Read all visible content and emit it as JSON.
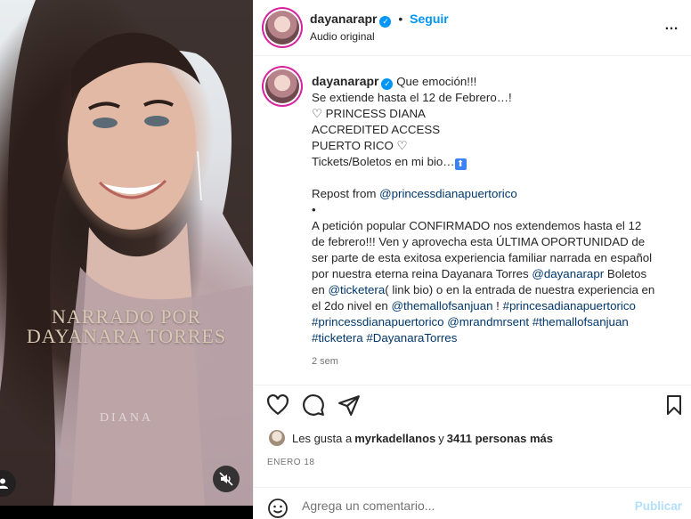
{
  "media": {
    "overlay_line1": "NARRADO POR",
    "overlay_line2": "DAYANARA TORRES",
    "watermark": "DIANA",
    "mute_icon": "speaker-muted-icon",
    "user_icon": "user-icon"
  },
  "header": {
    "username": "dayanarapr",
    "separator": "•",
    "follow_label": "Seguir",
    "subtitle": "Audio original",
    "more_icon": "…"
  },
  "caption": {
    "username": "dayanarapr",
    "lines": {
      "l1": "Que emoción!!!",
      "l2": "Se extiende hasta el 12 de Febrero…!",
      "l3": "♡ PRINCESS DIANA",
      "l4": "ACCREDITED ACCESS",
      "l5": "PUERTO RICO ♡",
      "l6": "Tickets/Boletos en mi bio…",
      "l6_badge": "⬆",
      "l7_prefix": "Repost from ",
      "l7_link": "@princessdianapuertorico",
      "l8": "•",
      "l9": "A petición popular CONFIRMADO nos extendemos hasta el 12",
      "l10": "de febrero!!! Ven y aprovecha esta ÚLTIMA OPORTUNIDAD de",
      "l11": "ser parte de esta exitosa experiencia familiar narrada en español",
      "l12_prefix": "por nuestra eterna reina Dayanara Torres ",
      "l12_link": "@dayanarapr",
      "l12_suffix": " Boletos",
      "l13_prefix": "en ",
      "l13_link": "@ticketera",
      "l13_suffix": "( link bio) o en la entrada de nuestra experiencia en",
      "l14_prefix": "el 2do nivel en ",
      "l14_link1": "@themallofsanjuan",
      "l14_mid": " ! ",
      "l14_link2": "#princesadianapuertorico",
      "l15_link1": "#princessdianapuertorico",
      "l15_mid1": " ",
      "l15_link2": "@mrandmrsent",
      "l15_mid2": " ",
      "l15_link3": "#themallofsanjuan",
      "l16_link1": "#ticketera",
      "l16_mid": " ",
      "l16_link2": "#DayanaraTorres"
    },
    "time": "2 sem"
  },
  "actions": {
    "like_icon": "heart-icon",
    "comment_icon": "comment-icon",
    "share_icon": "share-icon",
    "save_icon": "bookmark-icon"
  },
  "likes": {
    "prefix": "Les gusta a ",
    "user": "myrkadellanos",
    "middle": " y ",
    "count": "3411 personas más"
  },
  "date": "ENERO 18",
  "composer": {
    "placeholder": "Agrega un comentario...",
    "publish_label": "Publicar",
    "emoji_icon": "smiley-icon"
  },
  "colors": {
    "link": "#00376b",
    "accent": "#0095f6",
    "muted": "#737373"
  }
}
